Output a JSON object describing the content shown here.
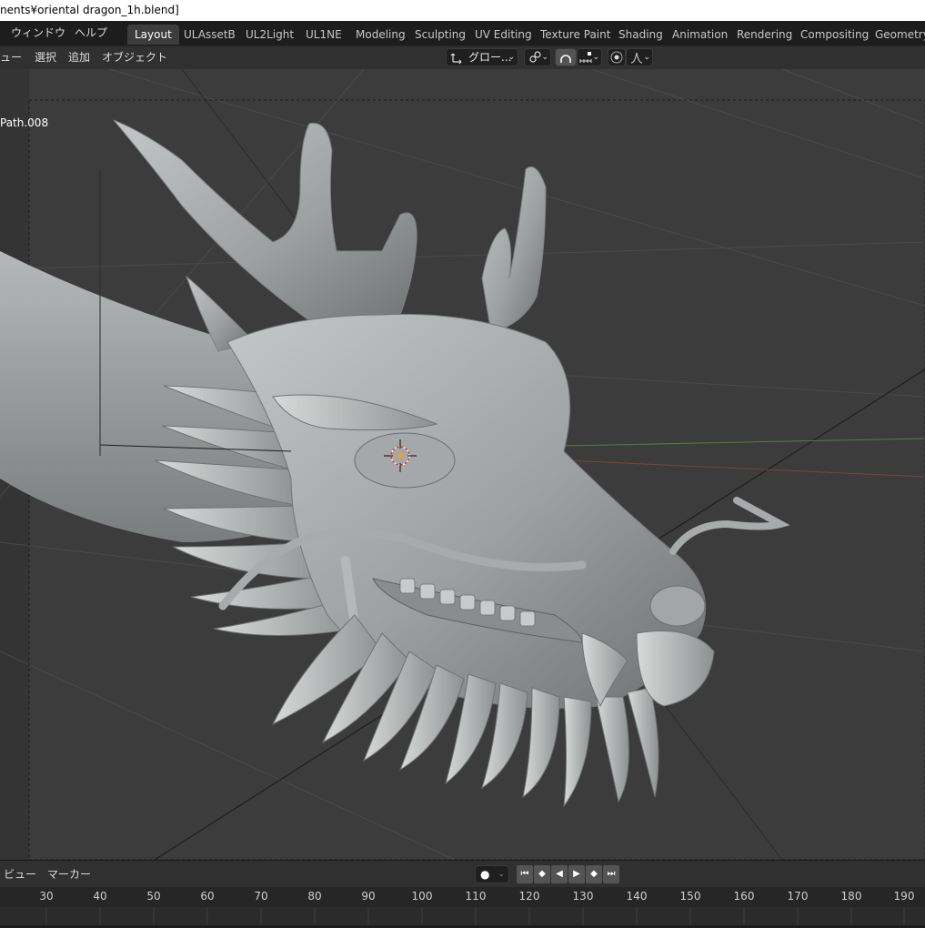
{
  "window": {
    "title": "nents¥oriental dragon_1h.blend]"
  },
  "top_menu": [
    "ウィンドウ",
    "ヘルプ"
  ],
  "workspace_tabs": [
    {
      "label": "Layout",
      "active": true
    },
    {
      "label": "ULAssetB"
    },
    {
      "label": "UL2Light"
    },
    {
      "label": "UL1NE"
    },
    {
      "label": "Modeling"
    },
    {
      "label": "Sculpting"
    },
    {
      "label": "UV Editing"
    },
    {
      "label": "Texture Paint"
    },
    {
      "label": "Shading"
    },
    {
      "label": "Animation"
    },
    {
      "label": "Rendering"
    },
    {
      "label": "Compositing"
    },
    {
      "label": "Geometry N"
    }
  ],
  "viewport_header": {
    "menus": [
      "ュー",
      "選択",
      "追加",
      "オブジェクト"
    ],
    "transform_orientation": "グロー...",
    "icons": [
      "transform-orientation-icon",
      "pivot-link-icon",
      "snap-icon",
      "snap-increment-icon",
      "proportional-edit-icon",
      "falloff-curve-icon"
    ]
  },
  "viewport": {
    "object_name": "Path.008",
    "colors": {
      "background": "#3c3c3c",
      "model": "#9a9d9d",
      "grid": "#4a4a4a"
    }
  },
  "timeline": {
    "menus": [
      "ビュー",
      "マーカー"
    ],
    "playback_buttons": [
      "jump-start",
      "prev-keyframe",
      "play-reverse",
      "play",
      "next-keyframe",
      "jump-end"
    ],
    "frame_ticks": [
      "30",
      "40",
      "50",
      "60",
      "70",
      "80",
      "90",
      "100",
      "110",
      "120",
      "130",
      "140",
      "150",
      "160",
      "170",
      "180",
      "190"
    ]
  }
}
